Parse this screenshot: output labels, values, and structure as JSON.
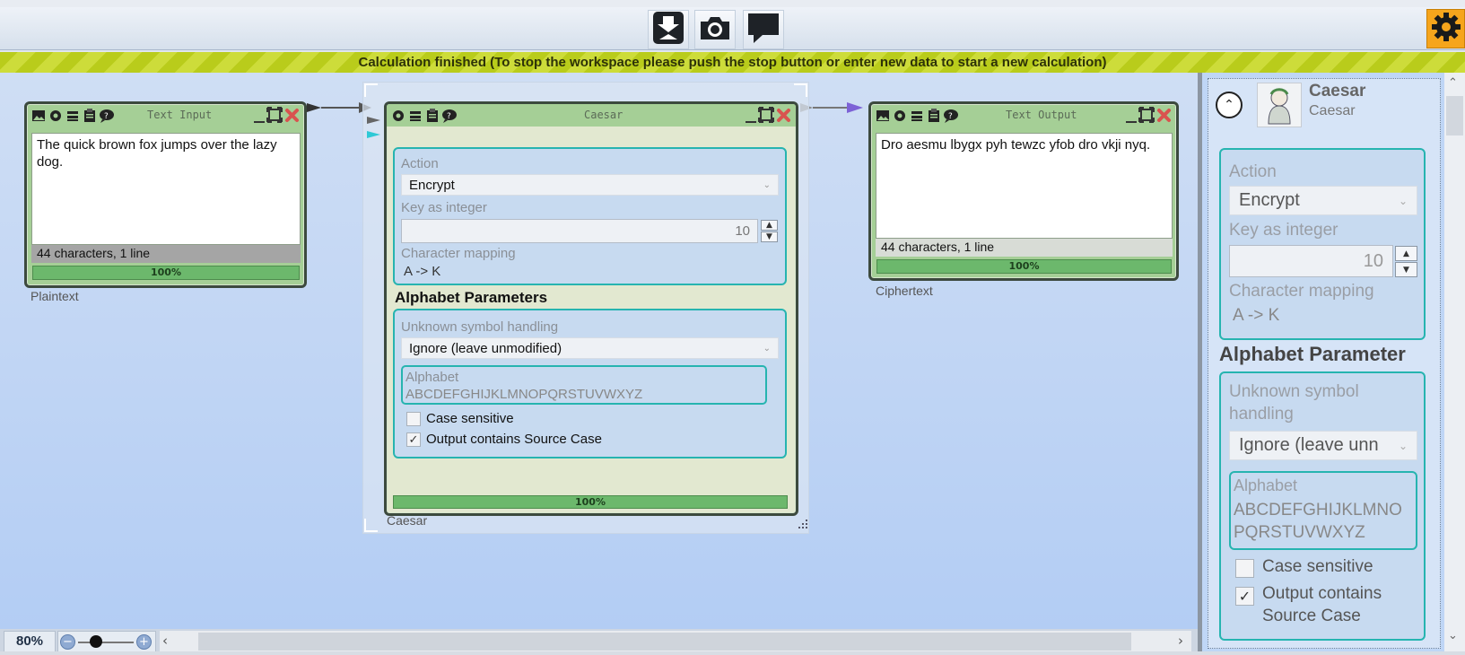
{
  "toolbar": {
    "buttons": [
      {
        "name": "import-export-icon"
      },
      {
        "name": "camera-icon"
      },
      {
        "name": "speech-bubble-icon"
      }
    ],
    "settings_icon": "gear-icon"
  },
  "status": {
    "message": "Calculation finished (To stop the workspace please push the stop button or enter new data to start a new calculation)"
  },
  "text_input": {
    "title": "Text Input",
    "content": "The quick brown fox jumps over the lazy dog.",
    "info": "44 characters,  1 line",
    "progress": "100%",
    "caption": "Plaintext"
  },
  "caesar": {
    "title": "Caesar",
    "action_label": "Action",
    "action_value": "Encrypt",
    "key_label": "Key as integer",
    "key_value": "10",
    "mapping_label": "Character mapping",
    "mapping_value": "A -> K",
    "alphabet_params_title": "Alphabet Parameters",
    "unknown_label": "Unknown symbol handling",
    "unknown_value": "Ignore (leave unmodified)",
    "alphabet_label": "Alphabet",
    "alphabet_value": "ABCDEFGHIJKLMNOPQRSTUVWXYZ",
    "case_sensitive_label": "Case sensitive",
    "case_sensitive_checked": false,
    "output_case_label": "Output contains Source Case",
    "output_case_checked": true,
    "progress": "100%",
    "caption": "Caesar"
  },
  "text_output": {
    "title": "Text Output",
    "content": "Dro aesmu lbygx pyh tewzc yfob dro vkji nyq.",
    "info": "44 characters,  1 line",
    "progress": "100%",
    "caption": "Ciphertext"
  },
  "panel": {
    "title": "Caesar",
    "subtitle": "Caesar",
    "action_label": "Action",
    "action_value": "Encrypt",
    "key_label": "Key as integer",
    "key_value": "10",
    "mapping_label": "Character mapping",
    "mapping_value": "A -> K",
    "alphabet_params_title": "Alphabet Parameter",
    "unknown_label_1": "Unknown symbol",
    "unknown_label_2": "handling",
    "unknown_value": "Ignore (leave unn",
    "alphabet_label": "Alphabet",
    "alphabet_value_1": "ABCDEFGHIJKLMNO",
    "alphabet_value_2": "PQRSTUVWXYZ",
    "case_sensitive_label": "Case sensitive",
    "output_case_label_1": "Output contains",
    "output_case_label_2": "Source Case"
  },
  "zoom": {
    "level": "80%",
    "slider_fraction": 0.33
  },
  "colors": {
    "accent_teal": "#26b4b0",
    "component_green": "#a5cf96",
    "progress_green": "#6cb86c",
    "status_yellow": "#b9cc1b",
    "settings_orange": "#f6a51c"
  }
}
